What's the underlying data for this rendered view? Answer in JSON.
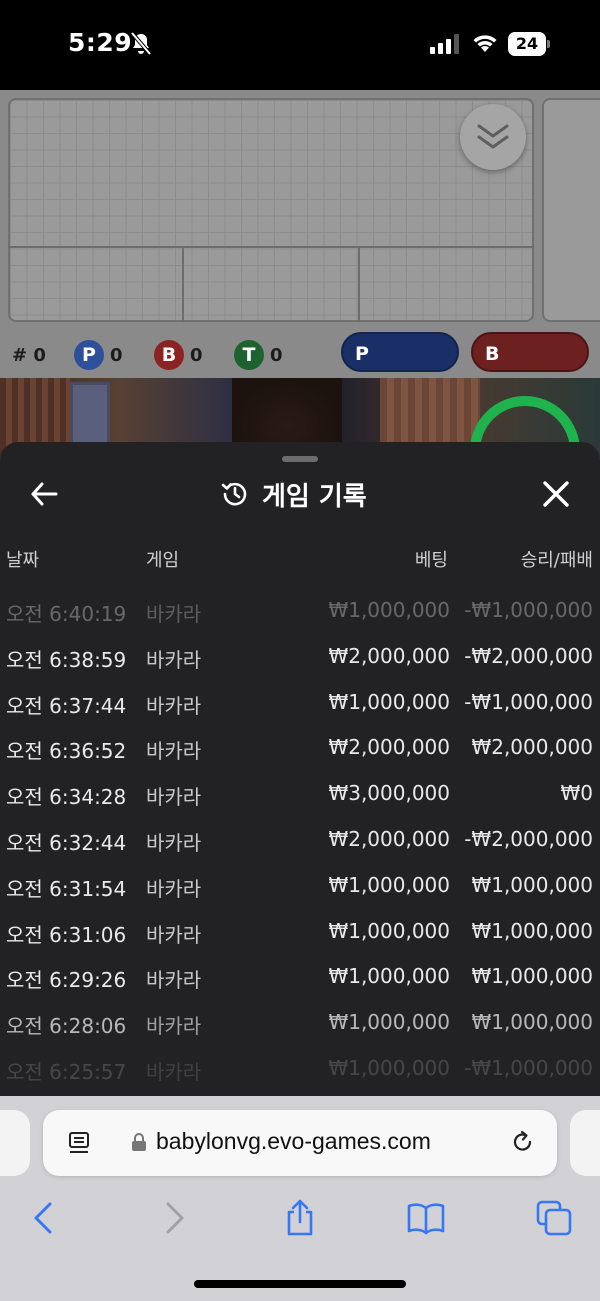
{
  "status_bar": {
    "time": "5:29",
    "battery": "24",
    "icons": [
      "bell-muted-icon",
      "cellular-signal-icon",
      "wifi-icon",
      "battery-icon"
    ]
  },
  "game": {
    "stats": {
      "hash": "# 0",
      "player_letter": "P",
      "player_count": "0",
      "banker_letter": "B",
      "banker_count": "0",
      "tie_letter": "T",
      "tie_count": "0"
    },
    "bet_buttons": {
      "player": "P",
      "banker": "B"
    },
    "colors": {
      "player": "#2f5bd0",
      "banker": "#c02a2a",
      "tie": "#1f8a3b"
    }
  },
  "history": {
    "title": "게임 기록",
    "columns": {
      "date": "날짜",
      "game": "게임",
      "bet": "베팅",
      "result": "승리/패배"
    },
    "rows": [
      {
        "date": "오전 6:40:19",
        "game": "바카라",
        "bet": "₩1,000,000",
        "result": "-₩1,000,000"
      },
      {
        "date": "오전 6:38:59",
        "game": "바카라",
        "bet": "₩2,000,000",
        "result": "-₩2,000,000"
      },
      {
        "date": "오전 6:37:44",
        "game": "바카라",
        "bet": "₩1,000,000",
        "result": "-₩1,000,000"
      },
      {
        "date": "오전 6:36:52",
        "game": "바카라",
        "bet": "₩2,000,000",
        "result": "₩2,000,000"
      },
      {
        "date": "오전 6:34:28",
        "game": "바카라",
        "bet": "₩3,000,000",
        "result": "₩0"
      },
      {
        "date": "오전 6:32:44",
        "game": "바카라",
        "bet": "₩2,000,000",
        "result": "-₩2,000,000"
      },
      {
        "date": "오전 6:31:54",
        "game": "바카라",
        "bet": "₩1,000,000",
        "result": "₩1,000,000"
      },
      {
        "date": "오전 6:31:06",
        "game": "바카라",
        "bet": "₩1,000,000",
        "result": "₩1,000,000"
      },
      {
        "date": "오전 6:29:26",
        "game": "바카라",
        "bet": "₩1,000,000",
        "result": "₩1,000,000"
      },
      {
        "date": "오전 6:28:06",
        "game": "바카라",
        "bet": "₩1,000,000",
        "result": "₩1,000,000"
      },
      {
        "date": "오전 6:25:57",
        "game": "바카라",
        "bet": "₩1,000,000",
        "result": "-₩1,000,000"
      }
    ]
  },
  "browser": {
    "url": "babylonvg.evo-games.com",
    "toolbar_icons": [
      "back-icon",
      "forward-icon",
      "share-icon",
      "bookmarks-icon",
      "tabs-icon"
    ],
    "accent": "#3478f6"
  }
}
